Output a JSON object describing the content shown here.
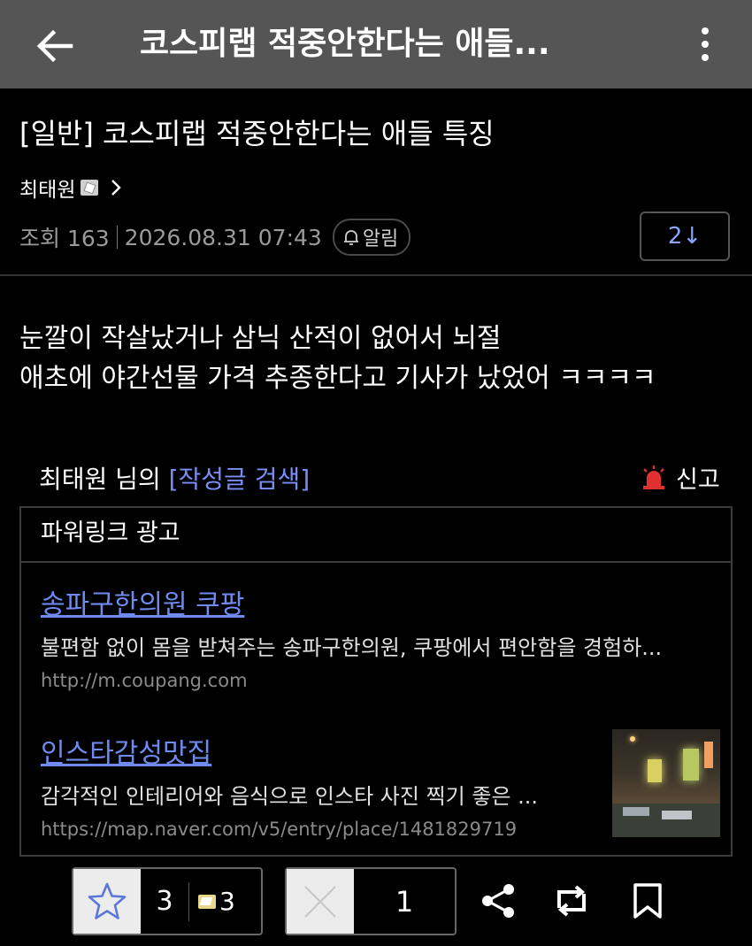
{
  "header": {
    "title": "코스피랩 적중안한다는 애들..."
  },
  "post": {
    "title": "[일반] 코스피랩 적중안한다는 애들 특징",
    "author": "최태원",
    "views_label": "조회 163",
    "date": "2026.08.31 07:43",
    "alarm_label": "알림",
    "comment_count": "2↓",
    "body_lines": [
      "눈깔이 작살났거나 삼닉 산적이 없어서 뇌절",
      "애초에 야간선물 가격 추종한다고 기사가 났었어 ㅋㅋㅋㅋ"
    ]
  },
  "author_search": {
    "prefix": "최태원 님의 ",
    "link_label": "[작성글 검색]",
    "report_label": "신고"
  },
  "ads": {
    "header": "파워링크 광고",
    "items": [
      {
        "title": "송파구한의원 쿠팡",
        "desc": "불편함 없이 몸을 받쳐주는 송파구한의원, 쿠팡에서 편안함을 경험하...",
        "url": "http://m.coupang.com"
      },
      {
        "title": "인스타감성맛집",
        "desc": "감각적인 인테리어와 음식으로 인스타 사진 찍기 좋은 ...",
        "url": "https://map.naver.com/v5/entry/place/1481829719"
      }
    ]
  },
  "footer": {
    "like_count": "3",
    "gift_count": "3",
    "dislike_count": "1"
  },
  "colors": {
    "header_bg": "#555555",
    "link": "#6f8bf0",
    "report_icon": "#e03030",
    "comment_count": "#8aa5ff"
  }
}
